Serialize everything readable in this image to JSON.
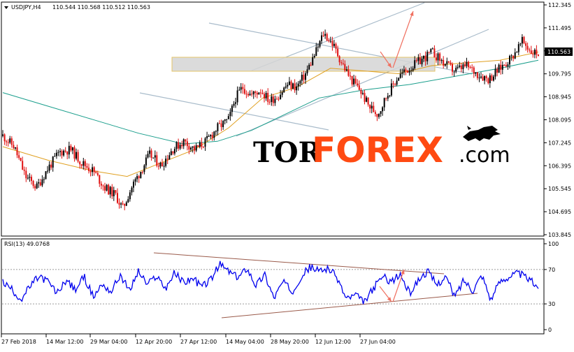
{
  "chart_data": {
    "type": "candlestick",
    "symbol_header": "USDJPY,H4",
    "ohlc_header": "110.544 110.568 110.512 110.563",
    "last_price_label": "110.563",
    "price_axis": {
      "ticks": [
        "112.345",
        "111.495",
        "110.645",
        "109.795",
        "108.945",
        "108.095",
        "107.245",
        "106.395",
        "105.545",
        "104.695",
        "103.845"
      ],
      "ylim": [
        103.845,
        112.345
      ]
    },
    "time_axis": {
      "ticks": [
        "27 Feb 2018",
        "14 Mar 12:00",
        "29 Mar 04:00",
        "12 Apr 20:00",
        "27 Apr 12:00",
        "14 May 04:00",
        "28 May 20:00",
        "12 Jun 12:00",
        "27 Jun 04:00"
      ]
    },
    "close_path": [
      [
        0,
        107.5
      ],
      [
        5,
        107.1
      ],
      [
        10,
        106.0
      ],
      [
        15,
        105.6
      ],
      [
        20,
        106.3
      ],
      [
        25,
        106.9
      ],
      [
        30,
        107.0
      ],
      [
        35,
        106.5
      ],
      [
        40,
        106.2
      ],
      [
        45,
        105.6
      ],
      [
        50,
        105.3
      ],
      [
        53,
        104.8
      ],
      [
        57,
        105.6
      ],
      [
        61,
        106.2
      ],
      [
        65,
        106.8
      ],
      [
        70,
        106.4
      ],
      [
        75,
        107.0
      ],
      [
        80,
        107.3
      ],
      [
        85,
        107.0
      ],
      [
        90,
        107.3
      ],
      [
        95,
        107.8
      ],
      [
        100,
        108.1
      ],
      [
        103,
        108.9
      ],
      [
        106,
        109.3
      ],
      [
        110,
        109.0
      ],
      [
        114,
        109.2
      ],
      [
        118,
        108.8
      ],
      [
        122,
        109.0
      ],
      [
        126,
        109.4
      ],
      [
        130,
        109.3
      ],
      [
        134,
        109.8
      ],
      [
        138,
        110.5
      ],
      [
        142,
        111.3
      ],
      [
        146,
        110.9
      ],
      [
        150,
        110.2
      ],
      [
        154,
        109.6
      ],
      [
        158,
        109.2
      ],
      [
        162,
        108.6
      ],
      [
        166,
        108.3
      ],
      [
        170,
        109.0
      ],
      [
        175,
        109.7
      ],
      [
        180,
        110.0
      ],
      [
        185,
        110.3
      ],
      [
        190,
        110.6
      ],
      [
        195,
        110.2
      ],
      [
        200,
        109.9
      ],
      [
        205,
        110.1
      ],
      [
        210,
        109.8
      ],
      [
        215,
        109.6
      ],
      [
        220,
        110.0
      ],
      [
        225,
        110.4
      ],
      [
        230,
        111.0
      ],
      [
        234,
        110.6
      ],
      [
        237,
        110.56
      ]
    ],
    "ma_slow": [
      [
        0,
        109.1
      ],
      [
        20,
        108.6
      ],
      [
        40,
        108.1
      ],
      [
        60,
        107.6
      ],
      [
        80,
        107.2
      ],
      [
        95,
        107.3
      ],
      [
        110,
        107.7
      ],
      [
        125,
        108.3
      ],
      [
        140,
        108.9
      ],
      [
        160,
        109.2
      ],
      [
        180,
        109.4
      ],
      [
        200,
        109.7
      ],
      [
        220,
        110.0
      ],
      [
        237,
        110.3
      ]
    ],
    "ma_fast": [
      [
        0,
        107.1
      ],
      [
        20,
        106.6
      ],
      [
        40,
        106.2
      ],
      [
        55,
        106.0
      ],
      [
        70,
        106.5
      ],
      [
        85,
        107.0
      ],
      [
        100,
        107.8
      ],
      [
        115,
        108.9
      ],
      [
        130,
        109.3
      ],
      [
        145,
        110.0
      ],
      [
        160,
        109.9
      ],
      [
        175,
        109.8
      ],
      [
        190,
        110.1
      ],
      [
        205,
        110.2
      ],
      [
        220,
        110.3
      ],
      [
        237,
        110.6
      ]
    ],
    "rsi": {
      "label": "RSI(13) 49.0768",
      "ticks": [
        "100",
        "70",
        "30",
        "0"
      ],
      "ylim": [
        0,
        100
      ],
      "path": [
        [
          0,
          55
        ],
        [
          4,
          47
        ],
        [
          8,
          35
        ],
        [
          12,
          50
        ],
        [
          16,
          62
        ],
        [
          20,
          56
        ],
        [
          24,
          42
        ],
        [
          28,
          58
        ],
        [
          32,
          46
        ],
        [
          36,
          62
        ],
        [
          40,
          38
        ],
        [
          44,
          53
        ],
        [
          48,
          44
        ],
        [
          52,
          64
        ],
        [
          56,
          45
        ],
        [
          60,
          68
        ],
        [
          64,
          52
        ],
        [
          68,
          63
        ],
        [
          72,
          48
        ],
        [
          76,
          66
        ],
        [
          80,
          55
        ],
        [
          84,
          60
        ],
        [
          88,
          50
        ],
        [
          92,
          58
        ],
        [
          96,
          76
        ],
        [
          100,
          68
        ],
        [
          104,
          60
        ],
        [
          108,
          72
        ],
        [
          112,
          52
        ],
        [
          116,
          64
        ],
        [
          120,
          37
        ],
        [
          124,
          56
        ],
        [
          128,
          44
        ],
        [
          132,
          62
        ],
        [
          136,
          73
        ],
        [
          140,
          68
        ],
        [
          144,
          72
        ],
        [
          148,
          60
        ],
        [
          152,
          36
        ],
        [
          156,
          40
        ],
        [
          160,
          32
        ],
        [
          164,
          48
        ],
        [
          168,
          62
        ],
        [
          172,
          56
        ],
        [
          176,
          64
        ],
        [
          180,
          42
        ],
        [
          184,
          58
        ],
        [
          188,
          68
        ],
        [
          192,
          52
        ],
        [
          196,
          62
        ],
        [
          200,
          38
        ],
        [
          204,
          58
        ],
        [
          208,
          46
        ],
        [
          212,
          64
        ],
        [
          216,
          35
        ],
        [
          220,
          56
        ],
        [
          224,
          62
        ],
        [
          228,
          66
        ],
        [
          232,
          60
        ],
        [
          236,
          52
        ],
        [
          237,
          49
        ]
      ]
    },
    "colors": {
      "bull_candle": "#000000",
      "bear_candle": "#e01010",
      "ma_fast": "#e0a020",
      "ma_slow": "#1a9e8c",
      "channel": "#a9bccb",
      "zone": "#d5d5d5",
      "zone_border": "#e6c46a",
      "projection": "#f07060",
      "rsi_line": "#0000ee",
      "rsi_trend": "#9a5a4a",
      "last_price_bg": "#000000"
    }
  },
  "watermark": {
    "part1": "TOR",
    "part2": "FOREX",
    "part3": ".com"
  }
}
